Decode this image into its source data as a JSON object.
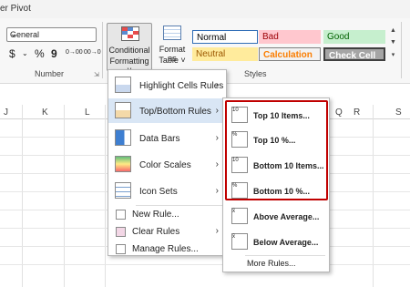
{
  "title": {
    "fragment": "er Pivot"
  },
  "ribbon": {
    "number_format": "General",
    "number_symbols": [
      "$",
      "~",
      "%",
      "9",
      "0→00",
      "00→0"
    ],
    "number_group_label": "Number",
    "styles_group_label": "Styles",
    "conditional_formatting": {
      "line1": "Conditional",
      "line2": "Formatting ˅"
    },
    "format_as_table": {
      "line1": "Format as",
      "line2": "Table ˅"
    },
    "cell_styles": {
      "normal": "Normal",
      "bad": "Bad",
      "good": "Good",
      "neutral": "Neutral",
      "calculation": "Calculation",
      "check_cell": "Check Cell"
    }
  },
  "columns": [
    "J",
    "K",
    "L",
    "Q",
    "R",
    "S"
  ],
  "cf_menu": {
    "items": [
      {
        "label": "Highlight Cells Rules",
        "icon": "highlight-cells-icon"
      },
      {
        "label": "Top/Bottom Rules",
        "icon": "top-bottom-icon"
      },
      {
        "label": "Data Bars",
        "icon": "data-bars-icon"
      },
      {
        "label": "Color Scales",
        "icon": "color-scales-icon"
      },
      {
        "label": "Icon Sets",
        "icon": "icon-sets-icon"
      }
    ],
    "actions": [
      "New Rule...",
      "Clear Rules",
      "Manage Rules..."
    ]
  },
  "topbottom_menu": {
    "items": [
      {
        "label": "Top 10 Items...",
        "icon_text": "10"
      },
      {
        "label": "Top 10 %...",
        "icon_text": "%"
      },
      {
        "label": "Bottom 10 Items...",
        "icon_text": "10"
      },
      {
        "label": "Bottom 10 %...",
        "icon_text": "%"
      },
      {
        "label": "Above Average...",
        "icon_text": "x̄"
      },
      {
        "label": "Below Average...",
        "icon_text": "x̄"
      }
    ],
    "more": "More Rules..."
  },
  "colors": {
    "highlight": "#d9e6f5",
    "red_outline": "#c00000"
  }
}
